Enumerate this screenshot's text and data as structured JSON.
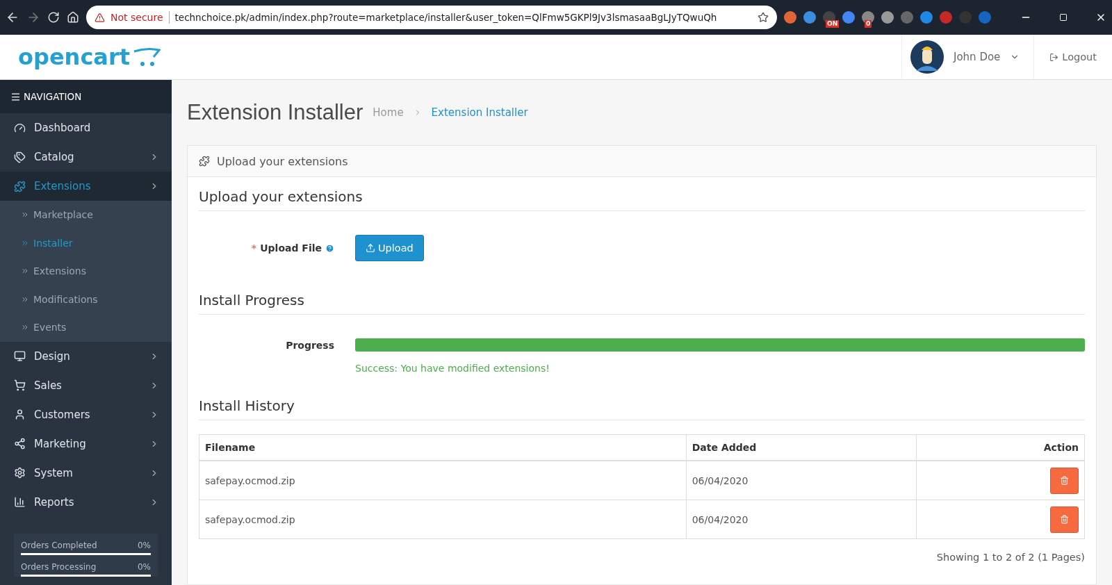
{
  "browser": {
    "security": "Not secure",
    "url": "technchoice.pk/admin/index.php?route=marketplace/installer&user_token=QlFmw5GKPl9Jv3lsmasaaBgLJyTQwuQh",
    "extensions": [
      {
        "color": "#e0663a"
      },
      {
        "color": "#3a8de0"
      },
      {
        "badge": "ON",
        "color": "#444444"
      },
      {
        "color": "#4285f4"
      },
      {
        "badge": "0",
        "color": "#888888"
      },
      {
        "color": "#999999"
      },
      {
        "color": "#666666"
      },
      {
        "color": "#1e88e5"
      },
      {
        "color": "#c62828"
      },
      {
        "color": "#333333"
      },
      {
        "color": "#1565c0"
      }
    ]
  },
  "header": {
    "logo": "opencart",
    "user": "John Doe",
    "logout": "Logout"
  },
  "sidebar": {
    "title": "NAVIGATION",
    "items": [
      {
        "label": "Dashboard",
        "expandable": false,
        "selected": false
      },
      {
        "label": "Catalog",
        "expandable": true,
        "selected": false
      },
      {
        "label": "Extensions",
        "expandable": true,
        "selected": true,
        "children": [
          {
            "label": "Marketplace",
            "selected": false
          },
          {
            "label": "Installer",
            "selected": true
          },
          {
            "label": "Extensions",
            "selected": false
          },
          {
            "label": "Modifications",
            "selected": false
          },
          {
            "label": "Events",
            "selected": false
          }
        ]
      },
      {
        "label": "Design",
        "expandable": true,
        "selected": false
      },
      {
        "label": "Sales",
        "expandable": true,
        "selected": false
      },
      {
        "label": "Customers",
        "expandable": true,
        "selected": false
      },
      {
        "label": "Marketing",
        "expandable": true,
        "selected": false
      },
      {
        "label": "System",
        "expandable": true,
        "selected": false
      },
      {
        "label": "Reports",
        "expandable": true,
        "selected": false
      }
    ],
    "stats": [
      {
        "label": "Orders Completed",
        "value": "0%",
        "level": 0
      },
      {
        "label": "Orders Processing",
        "value": "0%",
        "level": 0
      }
    ]
  },
  "page": {
    "title": "Extension Installer",
    "breadcrumbs": [
      {
        "label": "Home",
        "selected": false
      },
      {
        "label": "Extension Installer",
        "selected": true
      }
    ],
    "panel_title": "Upload your extensions",
    "upload_section": "Upload your extensions",
    "upload_required": "*",
    "upload_label": "Upload File",
    "upload_button": "Upload",
    "progress_section": "Install Progress",
    "progress_label": "Progress",
    "progress": {
      "level": 1
    },
    "progress_message": "Success: You have modified extensions!",
    "history_section": "Install History",
    "table": {
      "columns": [
        "Filename",
        "Date Added",
        "Action"
      ],
      "rows": [
        {
          "filename": "safepay.ocmod.zip",
          "date": "06/04/2020"
        },
        {
          "filename": "safepay.ocmod.zip",
          "date": "06/04/2020"
        }
      ]
    },
    "pagination": "Showing 1 to 2 of 2 (1 Pages)"
  }
}
